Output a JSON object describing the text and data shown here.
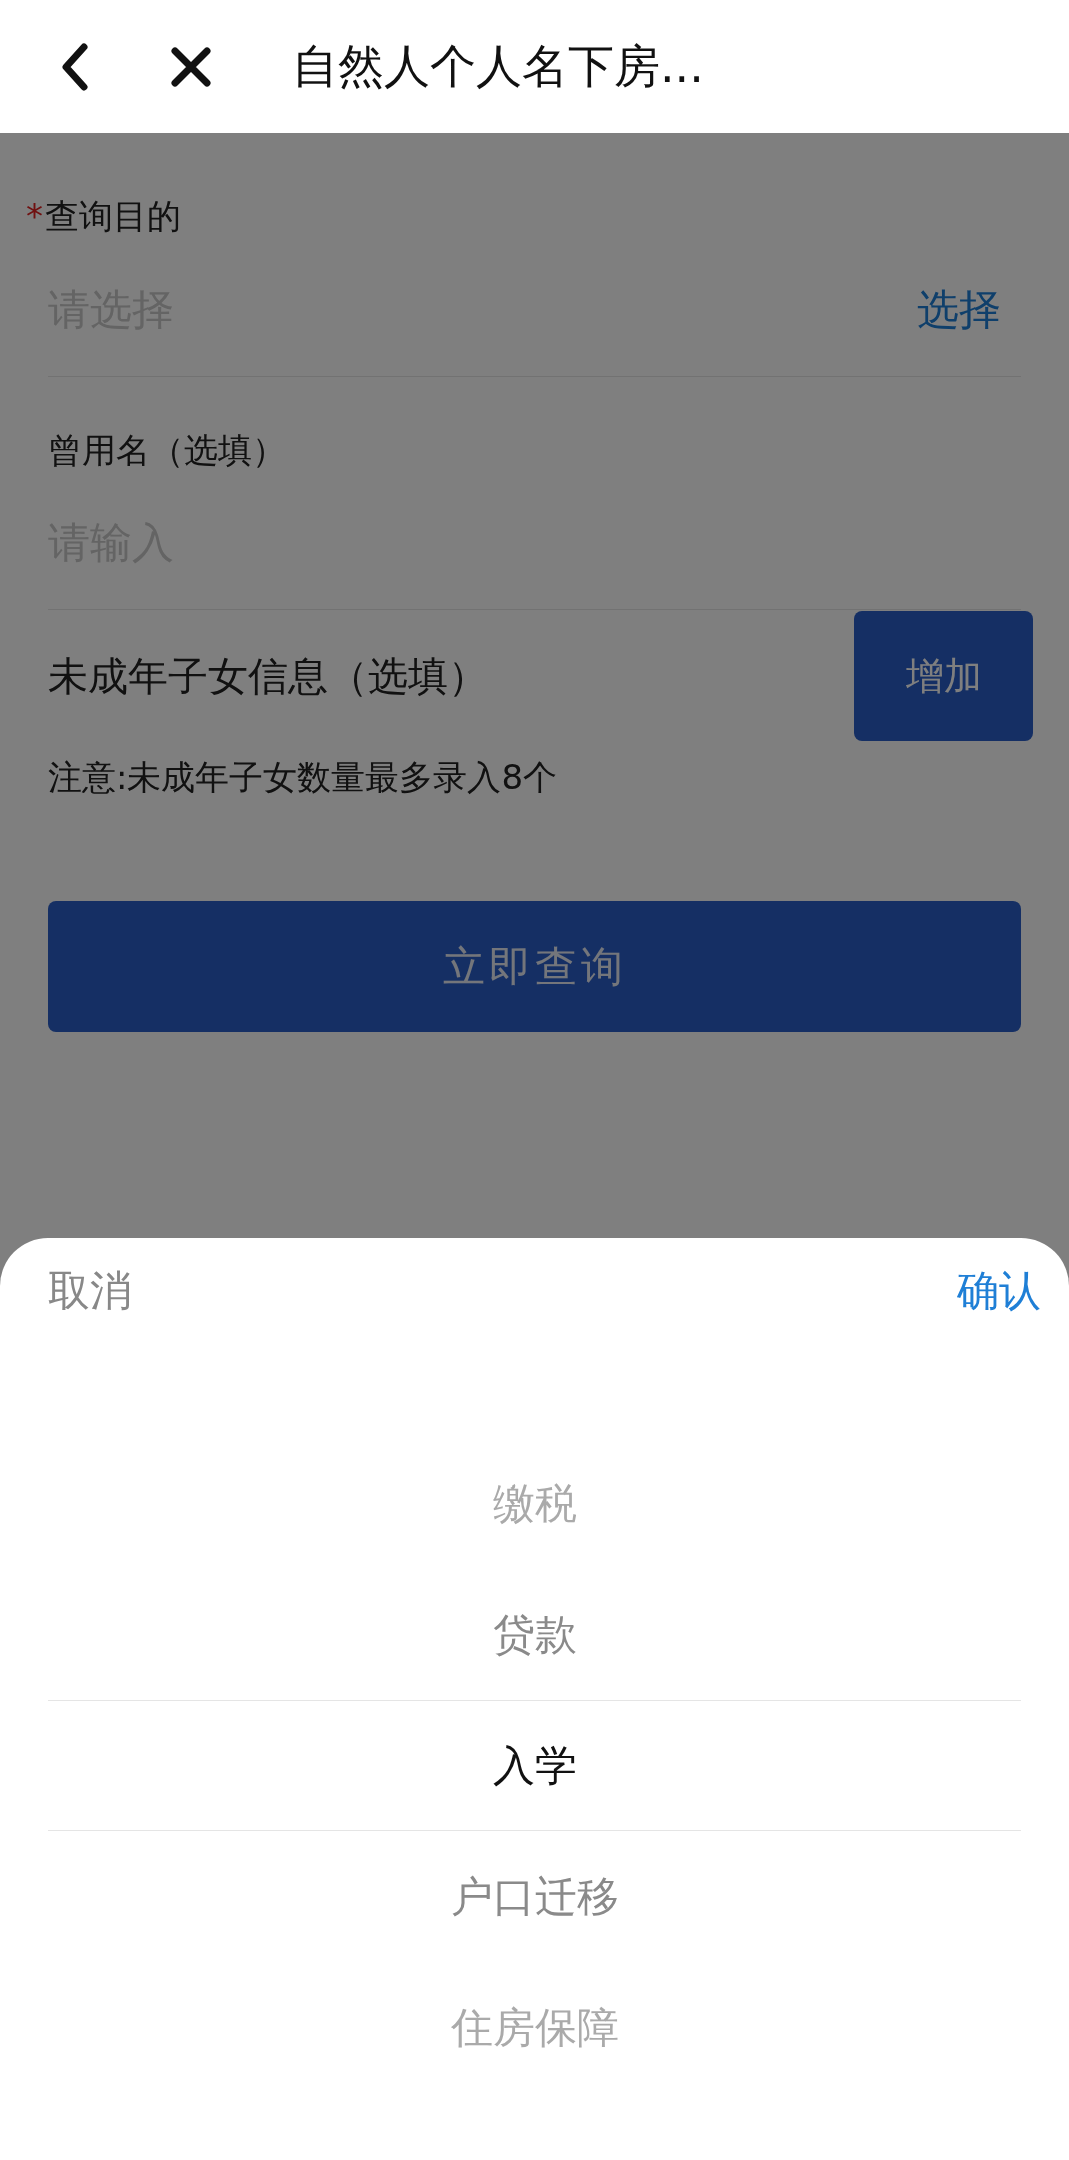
{
  "header": {
    "title": "自然人个人名下房..."
  },
  "form": {
    "purpose": {
      "required_mark": "*",
      "label": "查询目的",
      "placeholder": "请选择",
      "action": "选择"
    },
    "former_name": {
      "label": "曾用名（选填）",
      "placeholder": "请输入"
    },
    "children": {
      "label": "未成年子女信息（选填）",
      "button": "增加"
    },
    "note": "注意:未成年子女数量最多录入8个",
    "submit": "立即查询"
  },
  "picker": {
    "cancel": "取消",
    "confirm": "确认",
    "options": [
      {
        "label": "缴税",
        "selected": false
      },
      {
        "label": "贷款",
        "selected": false
      },
      {
        "label": "入学",
        "selected": true
      },
      {
        "label": "户口迁移",
        "selected": false
      },
      {
        "label": "住房保障",
        "selected": false
      }
    ]
  }
}
